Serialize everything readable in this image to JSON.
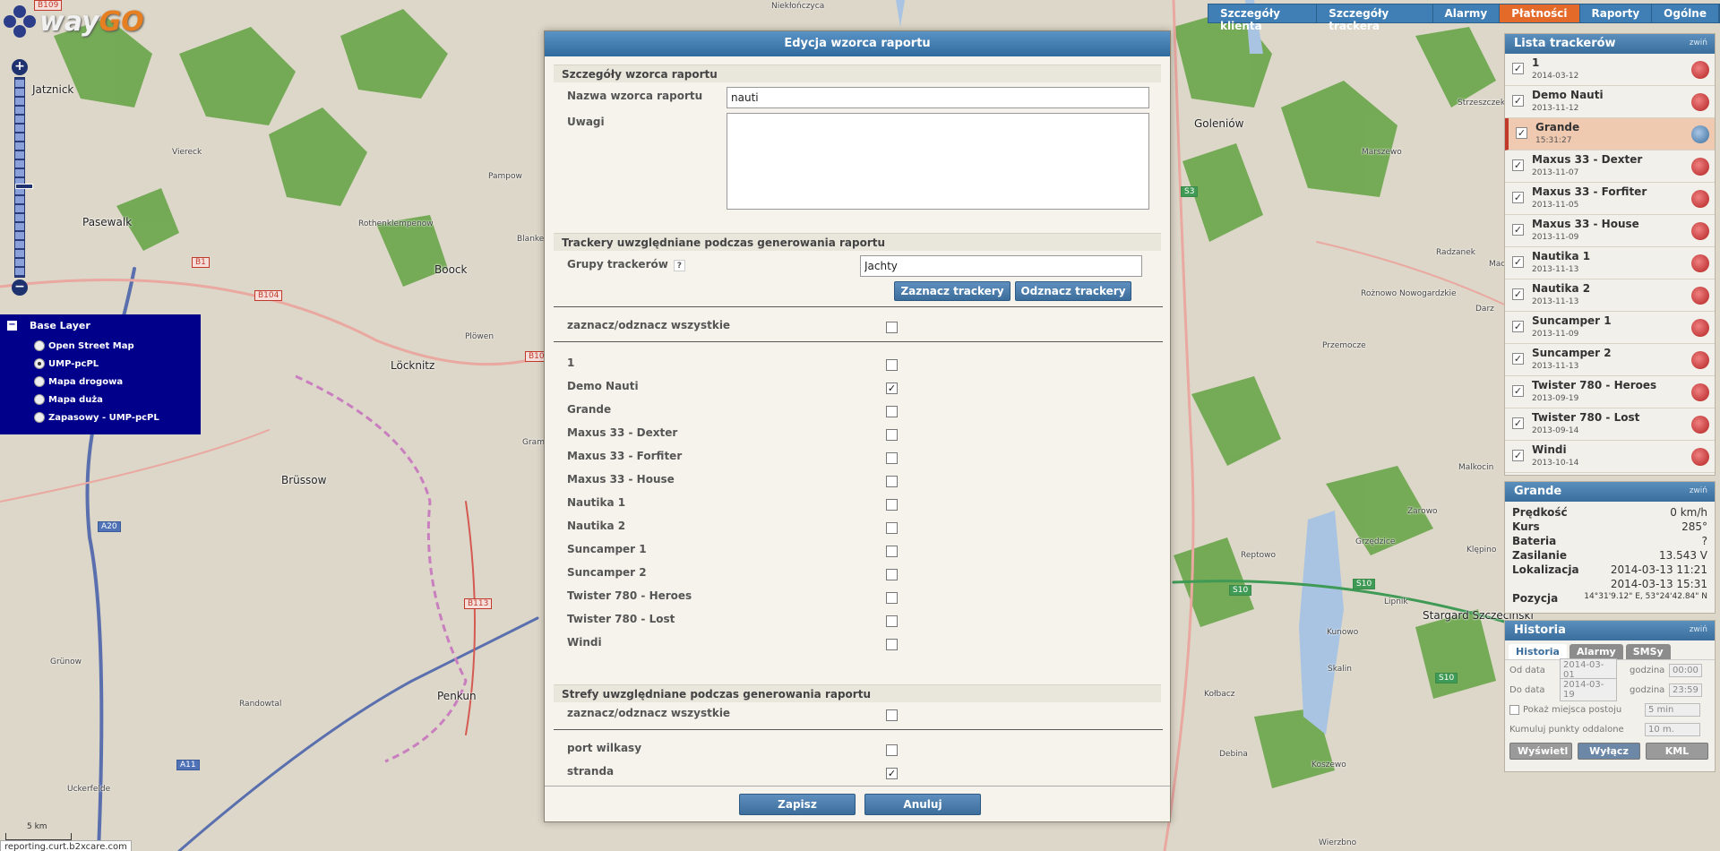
{
  "map": {
    "towns": [
      "Jatznick",
      "Pasewalk",
      "Boock",
      "Löcknitz",
      "Brüssow",
      "Penkun",
      "Goleniów",
      "Stargard Szczeciński",
      "Przemocze",
      "Reptowo",
      "Viereck",
      "Pampow",
      "Rothenklempenow",
      "Blanke",
      "Plöwen",
      "Grünow",
      "Randowtal",
      "Uckerfelde",
      "Gramb",
      "Radzanek",
      "Rożnowo Nowogardzkie",
      "Darz",
      "Maciejewo",
      "Marszewo",
      "Zarowo",
      "Grzędzice",
      "Klępino",
      "Lipnik",
      "Kunowo",
      "Skalin",
      "Kołbacz",
      "Debina",
      "Koszewo",
      "Wierzbno",
      "Niekłończyca",
      "Malkocin",
      "Strzeszczek"
    ],
    "roads": [
      "B109",
      "B104",
      "B10",
      "B113",
      "A20",
      "A11",
      "S3",
      "S10",
      "S10",
      "S10",
      "B1"
    ],
    "scale_label": "5 km",
    "status_url": "reporting.curt.b2xcare.com"
  },
  "logo": {
    "brand_a": "way",
    "brand_b": "GO"
  },
  "layers": {
    "title": "Base Layer",
    "options": [
      {
        "label": "Open Street Map",
        "selected": false
      },
      {
        "label": "UMP-pcPL",
        "selected": true
      },
      {
        "label": "Mapa drogowa",
        "selected": false
      },
      {
        "label": "Mapa duża",
        "selected": false
      },
      {
        "label": "Zapasowy - UMP-pcPL",
        "selected": false
      }
    ]
  },
  "topnav": {
    "tabs": [
      {
        "label": "Szczegóły klienta",
        "active": false
      },
      {
        "label": "Szczegóły trackera",
        "active": false
      },
      {
        "label": "Alarmy",
        "active": false
      },
      {
        "label": "Płatności",
        "active": true
      },
      {
        "label": "Raporty",
        "active": false
      },
      {
        "label": "Ogólne",
        "active": false
      }
    ]
  },
  "trackers_panel": {
    "title": "Lista trackerów",
    "collapse": "zwiń",
    "items": [
      {
        "name": "1",
        "date": "2014-03-12",
        "selected": false,
        "icon": "alarm-icon"
      },
      {
        "name": "Demo Nauti",
        "date": "2013-11-12",
        "selected": false,
        "icon": "alarm-icon"
      },
      {
        "name": "Grande",
        "date": "15:31:27",
        "selected": true,
        "icon": "plane-icon"
      },
      {
        "name": "Maxus 33 - Dexter",
        "date": "2013-11-07",
        "selected": false,
        "icon": "alarm-icon"
      },
      {
        "name": "Maxus 33 - Forfiter",
        "date": "2013-11-05",
        "selected": false,
        "icon": "alarm-icon"
      },
      {
        "name": "Maxus 33 - House",
        "date": "2013-11-09",
        "selected": false,
        "icon": "alarm-icon"
      },
      {
        "name": "Nautika 1",
        "date": "2013-11-13",
        "selected": false,
        "icon": "alarm-icon"
      },
      {
        "name": "Nautika 2",
        "date": "2013-11-13",
        "selected": false,
        "icon": "alarm-icon"
      },
      {
        "name": "Suncamper 1",
        "date": "2013-11-09",
        "selected": false,
        "icon": "alarm-icon"
      },
      {
        "name": "Suncamper 2",
        "date": "2013-11-13",
        "selected": false,
        "icon": "alarm-icon"
      },
      {
        "name": "Twister 780 - Heroes",
        "date": "2013-09-19",
        "selected": false,
        "icon": "alarm-icon"
      },
      {
        "name": "Twister 780 - Lost",
        "date": "2013-09-14",
        "selected": false,
        "icon": "alarm-icon"
      },
      {
        "name": "Windi",
        "date": "2013-10-14",
        "selected": false,
        "icon": "alarm-icon"
      }
    ]
  },
  "details_panel": {
    "title": "Grande",
    "collapse": "zwiń",
    "rows": [
      {
        "k": "Prędkość",
        "v": "0 km/h"
      },
      {
        "k": "Kurs",
        "v": "285°"
      },
      {
        "k": "Bateria",
        "v": "?"
      },
      {
        "k": "Zasilanie",
        "v": "13.543 V"
      },
      {
        "k": "Lokalizacja",
        "v": "2014-03-13 11:21"
      },
      {
        "k": "",
        "v": "2014-03-13 15:31"
      },
      {
        "k": "Pozycja",
        "v": "14°31'9.12\" E, 53°24'42.84\" N"
      }
    ]
  },
  "history_panel": {
    "title": "Historia",
    "collapse": "zwiń",
    "tabs": [
      "Historia",
      "Alarmy",
      "SMSy"
    ],
    "from_label": "Od data",
    "from_date": "2014-03-01",
    "from_time_label": "godzina",
    "from_time": "00:00",
    "to_label": "Do data",
    "to_date": "2014-03-19",
    "to_time_label": "godzina",
    "to_time": "23:59",
    "stops_label": "Pokaż miejsca postoju",
    "stops_value": "5 min",
    "cumulate_label": "Kumuluj punkty oddalone",
    "cumulate_value": "10 m.",
    "buttons": [
      "Wyświetl",
      "Wyłącz",
      "KML"
    ]
  },
  "dialog": {
    "title": "Edycja wzorca raportu",
    "section_details": "Szczegóły wzorca raportu",
    "name_label": "Nazwa wzorca raportu",
    "name_value": "nauti",
    "notes_label": "Uwagi",
    "notes_value": "",
    "section_trackers": "Trackery uwzględniane podczas generowania raportu",
    "groups_label": "Grupy trackerów",
    "groups_help": "?",
    "groups_value": "Jachty",
    "select_button": "Zaznacz trackery",
    "deselect_button": "Odznacz trackery",
    "toggle_all_label": "zaznacz/odznacz wszystkie",
    "trackers": [
      {
        "label": "1",
        "checked": false
      },
      {
        "label": "Demo Nauti",
        "checked": true
      },
      {
        "label": "Grande",
        "checked": false
      },
      {
        "label": "Maxus 33 - Dexter",
        "checked": false
      },
      {
        "label": "Maxus 33 - Forfiter",
        "checked": false
      },
      {
        "label": "Maxus 33 - House",
        "checked": false
      },
      {
        "label": "Nautika 1",
        "checked": false
      },
      {
        "label": "Nautika 2",
        "checked": false
      },
      {
        "label": "Suncamper 1",
        "checked": false
      },
      {
        "label": "Suncamper 2",
        "checked": false
      },
      {
        "label": "Twister 780 - Heroes",
        "checked": false
      },
      {
        "label": "Twister 780 - Lost",
        "checked": false
      },
      {
        "label": "Windi",
        "checked": false
      }
    ],
    "section_zones": "Strefy uwzględniane podczas generowania raportu",
    "zones_toggle_all_label": "zaznacz/odznacz wszystkie",
    "zones": [
      {
        "label": "port wilkasy",
        "checked": false
      },
      {
        "label": "stranda",
        "checked": true
      }
    ],
    "save_button": "Zapisz",
    "cancel_button": "Anuluj"
  }
}
